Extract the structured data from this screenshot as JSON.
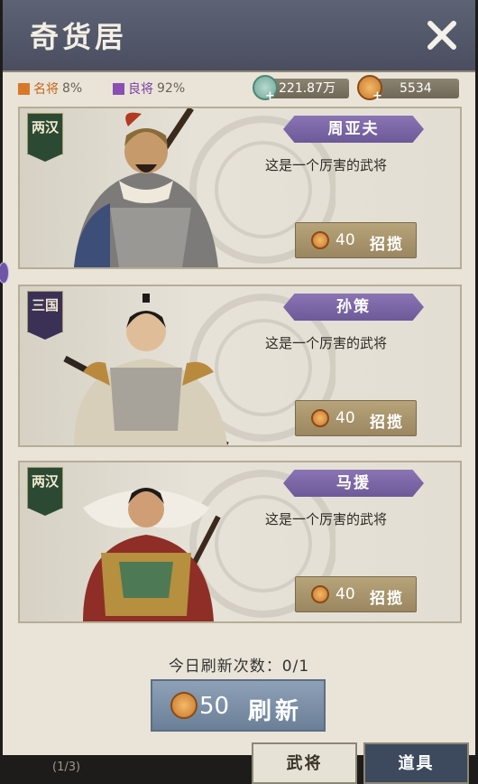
{
  "window": {
    "title": "奇货居"
  },
  "rates": [
    {
      "label": "名将",
      "value": "8%",
      "color": "#d8782b"
    },
    {
      "label": "良将",
      "value": "92%",
      "color": "#8a4fb3"
    }
  ],
  "currency": {
    "jade": "221.87万",
    "copper": "5534"
  },
  "generals": [
    {
      "dynasty": "两汉",
      "name": "周亚夫",
      "desc": "这是一个厉害的武将",
      "cost": "40",
      "action": "招揽"
    },
    {
      "dynasty": "三国",
      "name": "孙策",
      "desc": "这是一个厉害的武将",
      "cost": "40",
      "action": "招揽"
    },
    {
      "dynasty": "两汉",
      "name": "马援",
      "desc": "这是一个厉害的武将",
      "cost": "40",
      "action": "招揽"
    }
  ],
  "refresh": {
    "count_text": "今日刷新次数：0/1",
    "cost": "50",
    "label": "刷新"
  },
  "tabs": [
    {
      "label": "武将"
    },
    {
      "label": "道具"
    }
  ],
  "footer": {
    "page": "(1/3)"
  }
}
